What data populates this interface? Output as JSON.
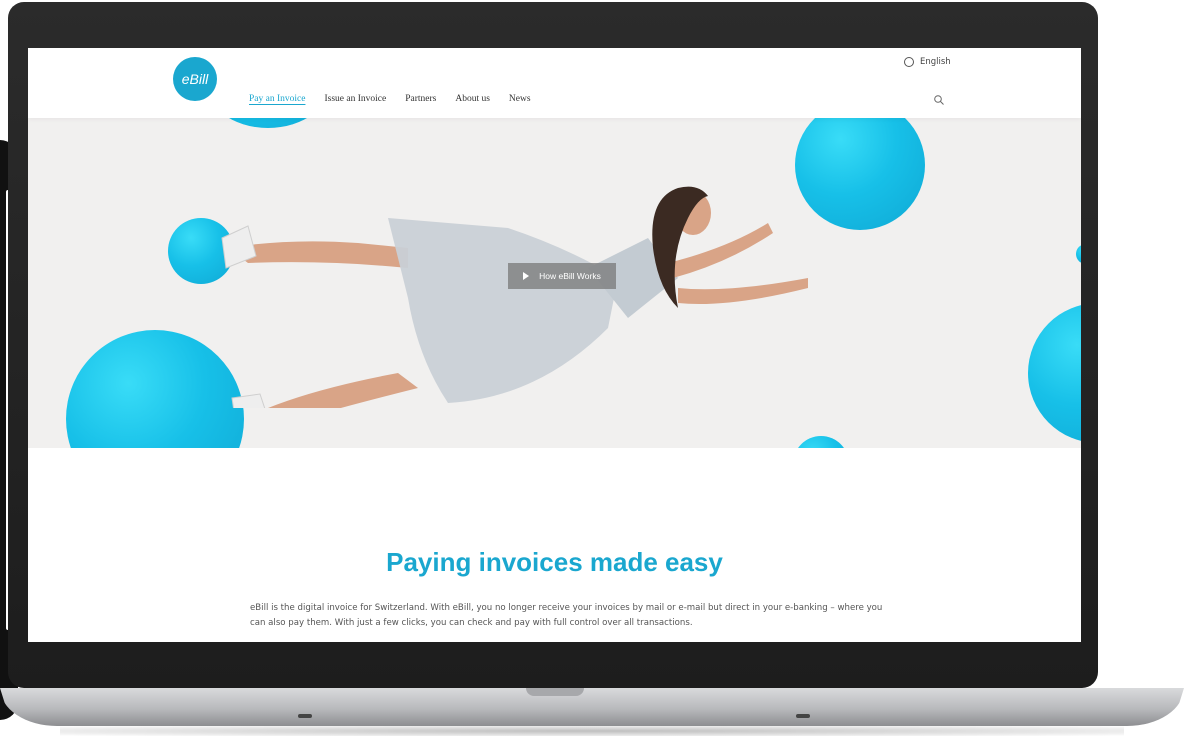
{
  "brand": {
    "logo_text": "eBill",
    "accent": "#1aa7cf"
  },
  "nav": {
    "items": [
      {
        "label": "Pay an Invoice",
        "active": true
      },
      {
        "label": "Issue an Invoice",
        "active": false
      },
      {
        "label": "Partners",
        "active": false
      },
      {
        "label": "About us",
        "active": false
      },
      {
        "label": "News",
        "active": false
      }
    ]
  },
  "language": {
    "label": "English",
    "icon": "globe-icon"
  },
  "search": {
    "icon": "search-icon"
  },
  "hero": {
    "video_button_label": "How eBill Works",
    "video_icon": "play-icon"
  },
  "content": {
    "headline": "Paying invoices made easy",
    "body": "eBill is the digital invoice for Switzerland. With eBill, you no longer receive your invoices by mail or e-mail but direct in your e-banking – where you can also pay them. With just a few clicks, you can check and pay with full control over all transactions."
  }
}
